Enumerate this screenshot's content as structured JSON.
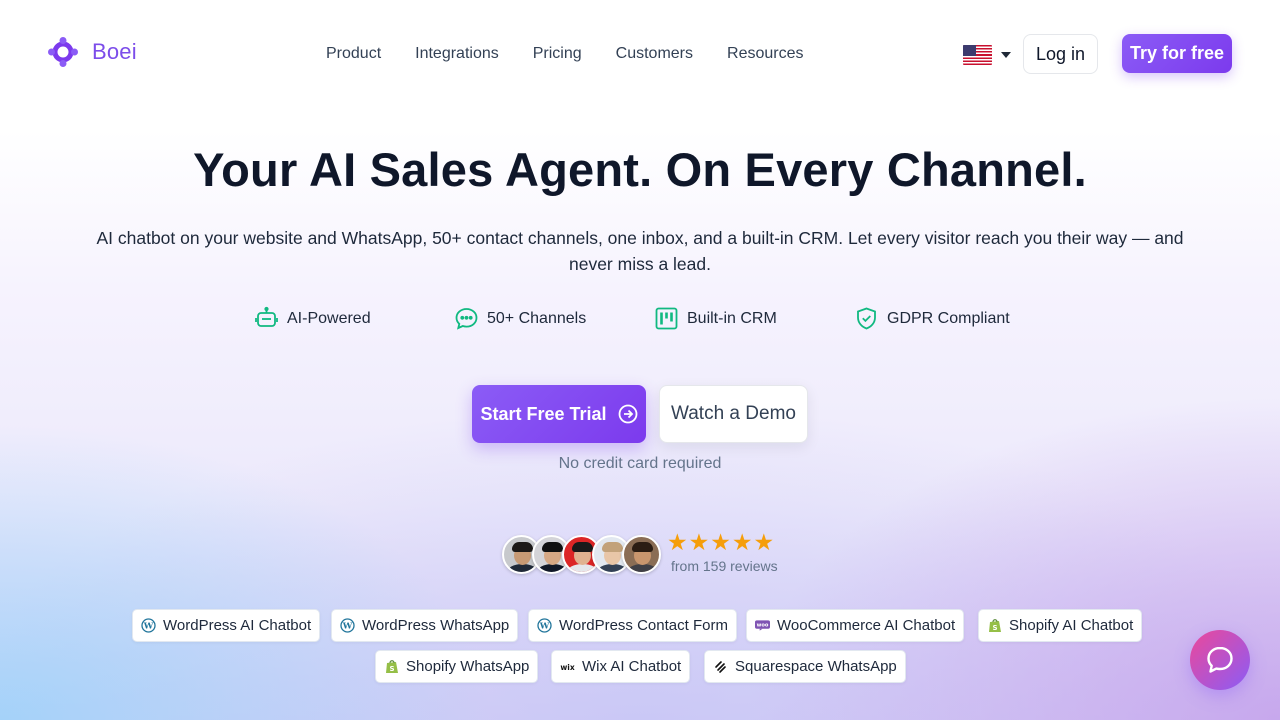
{
  "brand": {
    "name": "Boei",
    "accent": "#7c3aed"
  },
  "nav": {
    "links": [
      "Product",
      "Integrations",
      "Pricing",
      "Customers",
      "Resources"
    ],
    "language_flag": "us-flag-icon",
    "login_label": "Log in",
    "cta_label": "Try for free"
  },
  "hero": {
    "title": "Your AI Sales Agent. On Every Channel.",
    "subtitle": "AI chatbot on your website and WhatsApp, 50+ contact channels, one inbox, and a built-in CRM. Let every visitor reach you their way — and never miss a lead.",
    "features": [
      {
        "label": "AI-Powered",
        "icon": "robot-icon"
      },
      {
        "label": "50+ Channels",
        "icon": "chat-bubble-icon"
      },
      {
        "label": "Built-in CRM",
        "icon": "kanban-icon"
      },
      {
        "label": "GDPR Compliant",
        "icon": "shield-check-icon"
      }
    ],
    "primary_cta": "Start Free Trial",
    "secondary_cta": "Watch a Demo",
    "note": "No credit card required"
  },
  "social_proof": {
    "rating_stars": 5,
    "reviews_text": "from 159 reviews",
    "avatar_count": 5
  },
  "integrations": [
    {
      "label": "WordPress AI Chatbot",
      "icon": "wordpress-icon"
    },
    {
      "label": "WordPress WhatsApp",
      "icon": "wordpress-icon"
    },
    {
      "label": "WordPress Contact Form",
      "icon": "wordpress-icon"
    },
    {
      "label": "WooCommerce AI Chatbot",
      "icon": "woocommerce-icon"
    },
    {
      "label": "Shopify AI Chatbot",
      "icon": "shopify-icon"
    },
    {
      "label": "Shopify WhatsApp",
      "icon": "shopify-icon"
    },
    {
      "label": "Wix AI Chatbot",
      "icon": "wix-icon"
    },
    {
      "label": "Squarespace WhatsApp",
      "icon": "squarespace-icon"
    }
  ],
  "chat_launcher": {
    "icon": "chat-icon"
  }
}
